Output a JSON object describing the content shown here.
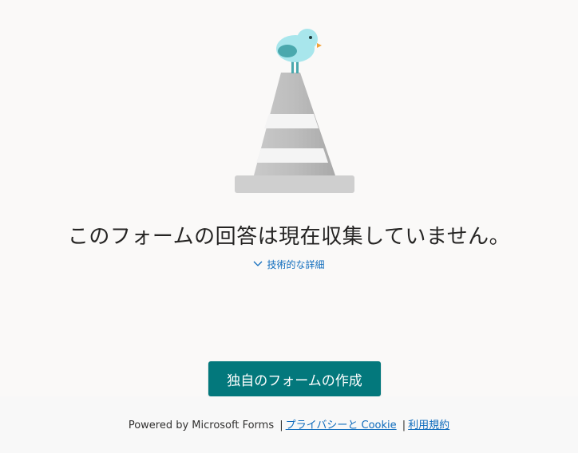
{
  "illustration": {
    "bird_icon": "bird-icon",
    "cone_icon": "traffic-cone-icon",
    "bird_color": "#a8e6ec",
    "bird_wing_color": "#4aa8ad",
    "bird_beak_color": "#f2a33a"
  },
  "message": "このフォームの回答は現在収集していません。",
  "tech_details": {
    "label": "技術的な詳細",
    "icon": "chevron-down-icon"
  },
  "create_button": {
    "label": "独自のフォームの作成",
    "color": "#03787c"
  },
  "footer": {
    "powered_by": "Powered by Microsoft Forms",
    "separator": "|",
    "privacy_link": "プライバシーと Cookie",
    "terms_link": "利用規約"
  }
}
